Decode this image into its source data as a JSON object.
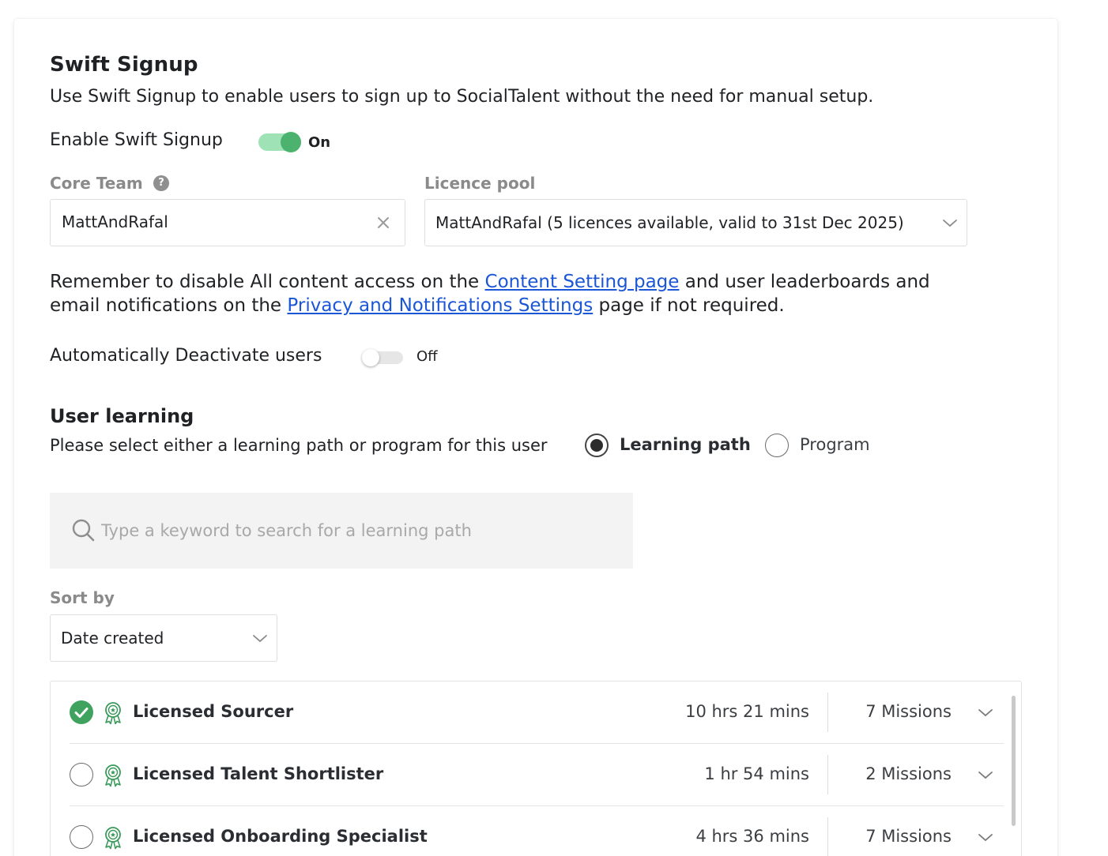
{
  "header": {
    "title": "Swift Signup",
    "description": "Use Swift Signup to enable users to sign up to SocialTalent without the need for manual setup."
  },
  "enable_swift_signup": {
    "label": "Enable Swift Signup",
    "state_text": "On"
  },
  "core_team": {
    "label": "Core Team",
    "help": "?",
    "value": "MattAndRafal"
  },
  "licence_pool": {
    "label": "Licence pool",
    "value": "MattAndRafal (5 licences available, valid to 31st Dec 2025)"
  },
  "reminder": {
    "line1_before": "Remember to disable All content access on the ",
    "link1": "Content Setting page",
    "line1_after": " and user leaderboards and",
    "line2_before": "email notifications on the ",
    "link2": "Privacy and Notifications Settings",
    "line2_after": " page if not required."
  },
  "auto_deactivate": {
    "label": "Automatically Deactivate users",
    "state_text": "Off"
  },
  "user_learning": {
    "title": "User learning",
    "prompt": "Please select either a learning path or program for this user",
    "option_learning_path": "Learning path",
    "option_program": "Program"
  },
  "search": {
    "placeholder": "Type a keyword to search for a learning path"
  },
  "sort": {
    "label": "Sort by",
    "value": "Date created"
  },
  "learning_paths": [
    {
      "title": "Licensed Sourcer",
      "duration": "10 hrs 21 mins",
      "missions": "7 Missions",
      "selected": true
    },
    {
      "title": "Licensed Talent Shortlister",
      "duration": "1 hr 54 mins",
      "missions": "2 Missions",
      "selected": false
    },
    {
      "title": "Licensed Onboarding Specialist",
      "duration": "4 hrs 36 mins",
      "missions": "7 Missions",
      "selected": false
    }
  ],
  "colors": {
    "toggle_on_track": "#9fe2b6",
    "toggle_on_knob": "#4cb36e",
    "link": "#1a56d6",
    "award_icon": "#3a9a5a",
    "check": "#3fa35f"
  }
}
